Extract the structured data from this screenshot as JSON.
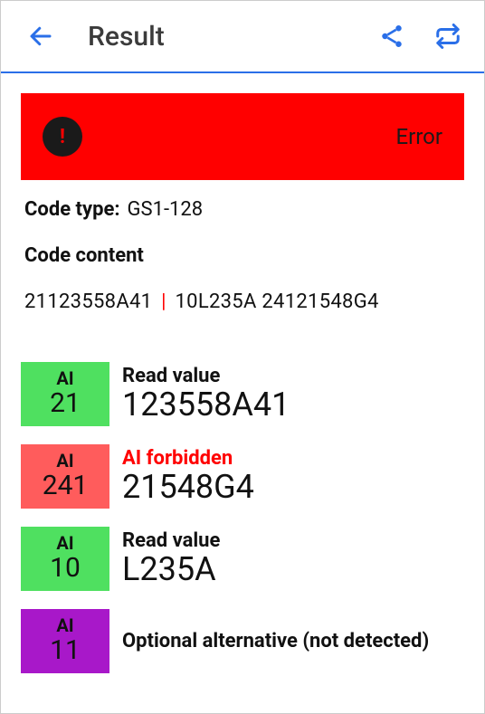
{
  "header": {
    "title": "Result"
  },
  "banner": {
    "status_label": "Error",
    "status_icon_glyph": "!"
  },
  "info": {
    "code_type_label": "Code type:",
    "code_type_value": "GS1-128",
    "code_content_label": "Code content",
    "raw_part1": "21123558A41",
    "raw_separator": "|",
    "raw_part2": "10L235A 24121548G4"
  },
  "labels": {
    "ai_title": "AI",
    "read_value": "Read value",
    "ai_forbidden": "AI forbidden",
    "optional_alt": "Optional alternative (not detected)"
  },
  "rows": {
    "0": {
      "ai": "21",
      "header_key": "read_value",
      "value": "123558A41",
      "color": "green"
    },
    "1": {
      "ai": "241",
      "header_key": "ai_forbidden",
      "value": "21548G4",
      "color": "rose"
    },
    "2": {
      "ai": "10",
      "header_key": "read_value",
      "value": "L235A",
      "color": "green"
    },
    "3": {
      "ai": "11",
      "header_key": "optional_alt",
      "value": "",
      "color": "purple"
    }
  }
}
